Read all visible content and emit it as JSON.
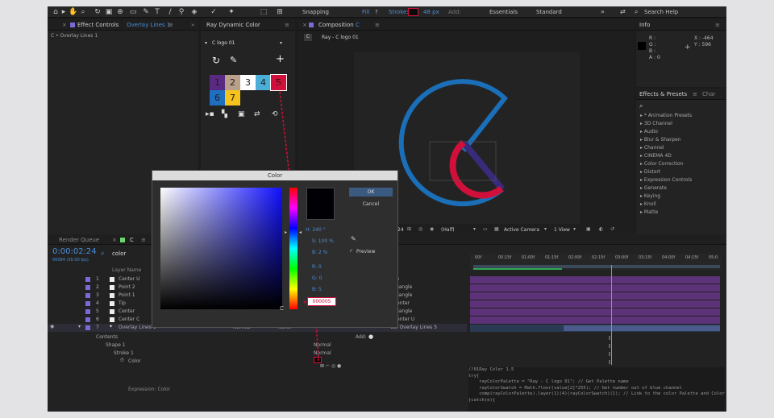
{
  "toolbar": {
    "snapping": "Snapping",
    "fill": "Fill",
    "fill_q": "?",
    "stroke": "Stroke:",
    "stroke_px": "48 px",
    "add": "Add:",
    "workspace1": "Essentials",
    "workspace2": "Standard",
    "search": "Search Help",
    "chev": "»"
  },
  "effect_controls": {
    "tab": "Effect Controls",
    "tab_layer": "Overlay Lines 1",
    "subtitle": "C • Overlay Lines 1"
  },
  "ray": {
    "tab": "Ray Dynamic Color",
    "dropdown": "C logo 01",
    "plus": "+",
    "swatches": [
      {
        "n": "1",
        "bg": "#5a2a82",
        "fg": "#1a1a1a"
      },
      {
        "n": "2",
        "bg": "#b9a08a",
        "fg": "#1a1a1a"
      },
      {
        "n": "3",
        "bg": "#ffffff",
        "fg": "#1a1a1a"
      },
      {
        "n": "4",
        "bg": "#4aaed9",
        "fg": "#1a1a1a"
      },
      {
        "n": "5",
        "bg": "#d0103a",
        "fg": "#1a1a1a"
      },
      {
        "n": "6",
        "bg": "#1f6fc0",
        "fg": "#1a1a1a"
      },
      {
        "n": "7",
        "bg": "#f6c21d",
        "fg": "#1a1a1a"
      }
    ]
  },
  "composition": {
    "tab": "Composition",
    "tab_name": "C",
    "sub": "Ray - C logo 01",
    "zoom_px": "24",
    "quality": "(Half)",
    "camera": "Active Camera",
    "view": "1 View"
  },
  "info": {
    "tab": "Info",
    "r": "R :",
    "g": "G :",
    "b": "B :",
    "a": "A : 0",
    "x": "X : -464",
    "y": "Y : 596"
  },
  "effects": {
    "tab": "Effects & Presets",
    "tab2": "Char",
    "search_ph": "",
    "items": [
      "* Animation Presets",
      "3D Channel",
      "Audio",
      "Blur & Sharpen",
      "Channel",
      "CINEMA 4D",
      "Color Correction",
      "Distort",
      "Expression Controls",
      "Generate",
      "Keying",
      "Knoll",
      "Matte"
    ]
  },
  "render": {
    "tab": "Render Queue",
    "tab2": "C"
  },
  "timeline": {
    "time": "0:00:02:24",
    "frames": "00084 (30.00 fps)",
    "search": "color",
    "col_name": "Layer Name",
    "ticks": [
      "00f",
      "00:15f",
      "01:00f",
      "01:15f",
      "02:00f",
      "02:15f",
      "03:00f",
      "03:15f",
      "04:00f",
      "04:15f",
      "05:0"
    ],
    "layers": [
      {
        "n": "1",
        "name": "Center U",
        "mode": "one"
      },
      {
        "n": "2",
        "name": "Point 2",
        "mode": ". Triangle"
      },
      {
        "n": "3",
        "name": "Point 1",
        "mode": ". Triangle"
      },
      {
        "n": "4",
        "name": "Tip",
        "mode": ". Center"
      },
      {
        "n": "5",
        "name": "Center",
        "mode": ". Triangle"
      },
      {
        "n": "6",
        "name": "Center C",
        "mode": ". Center U"
      },
      {
        "n": "7",
        "name": "Overlay Lines 1",
        "mode": "11. Overlay Lines 5"
      }
    ],
    "blend_normal": "Normal",
    "blend_none": "None",
    "add": "Add:",
    "contents": "Contents",
    "shape": "Shape 1",
    "stroke": "Stroke 1",
    "color": "Color",
    "expr_label": "Expression: Color"
  },
  "expression": {
    "lines": [
      "//01Ray Color 1.5",
      "try{",
      "    rayColorPalette = \"Ray - C logo 01\"; // Get Palette name",
      "    rayColorSwatch = Math.floor(value[2]*255); // Get number out of blue channel",
      "    comp(rayColorPalette).layer(1)(4)(rayColorSwatch)(1); // Link to the color Palette and Color",
      "}catch(e){"
    ]
  },
  "color_dialog": {
    "title": "Color",
    "ok": "OK",
    "cancel": "Cancel",
    "h": "H: 240 °",
    "s": "S: 100 %",
    "b": "B: 2 %",
    "r": "R: 0",
    "g": "G: 0",
    "bb": "B: 5",
    "hex_prefix": "#",
    "hex": "000005",
    "preview": "Preview"
  }
}
